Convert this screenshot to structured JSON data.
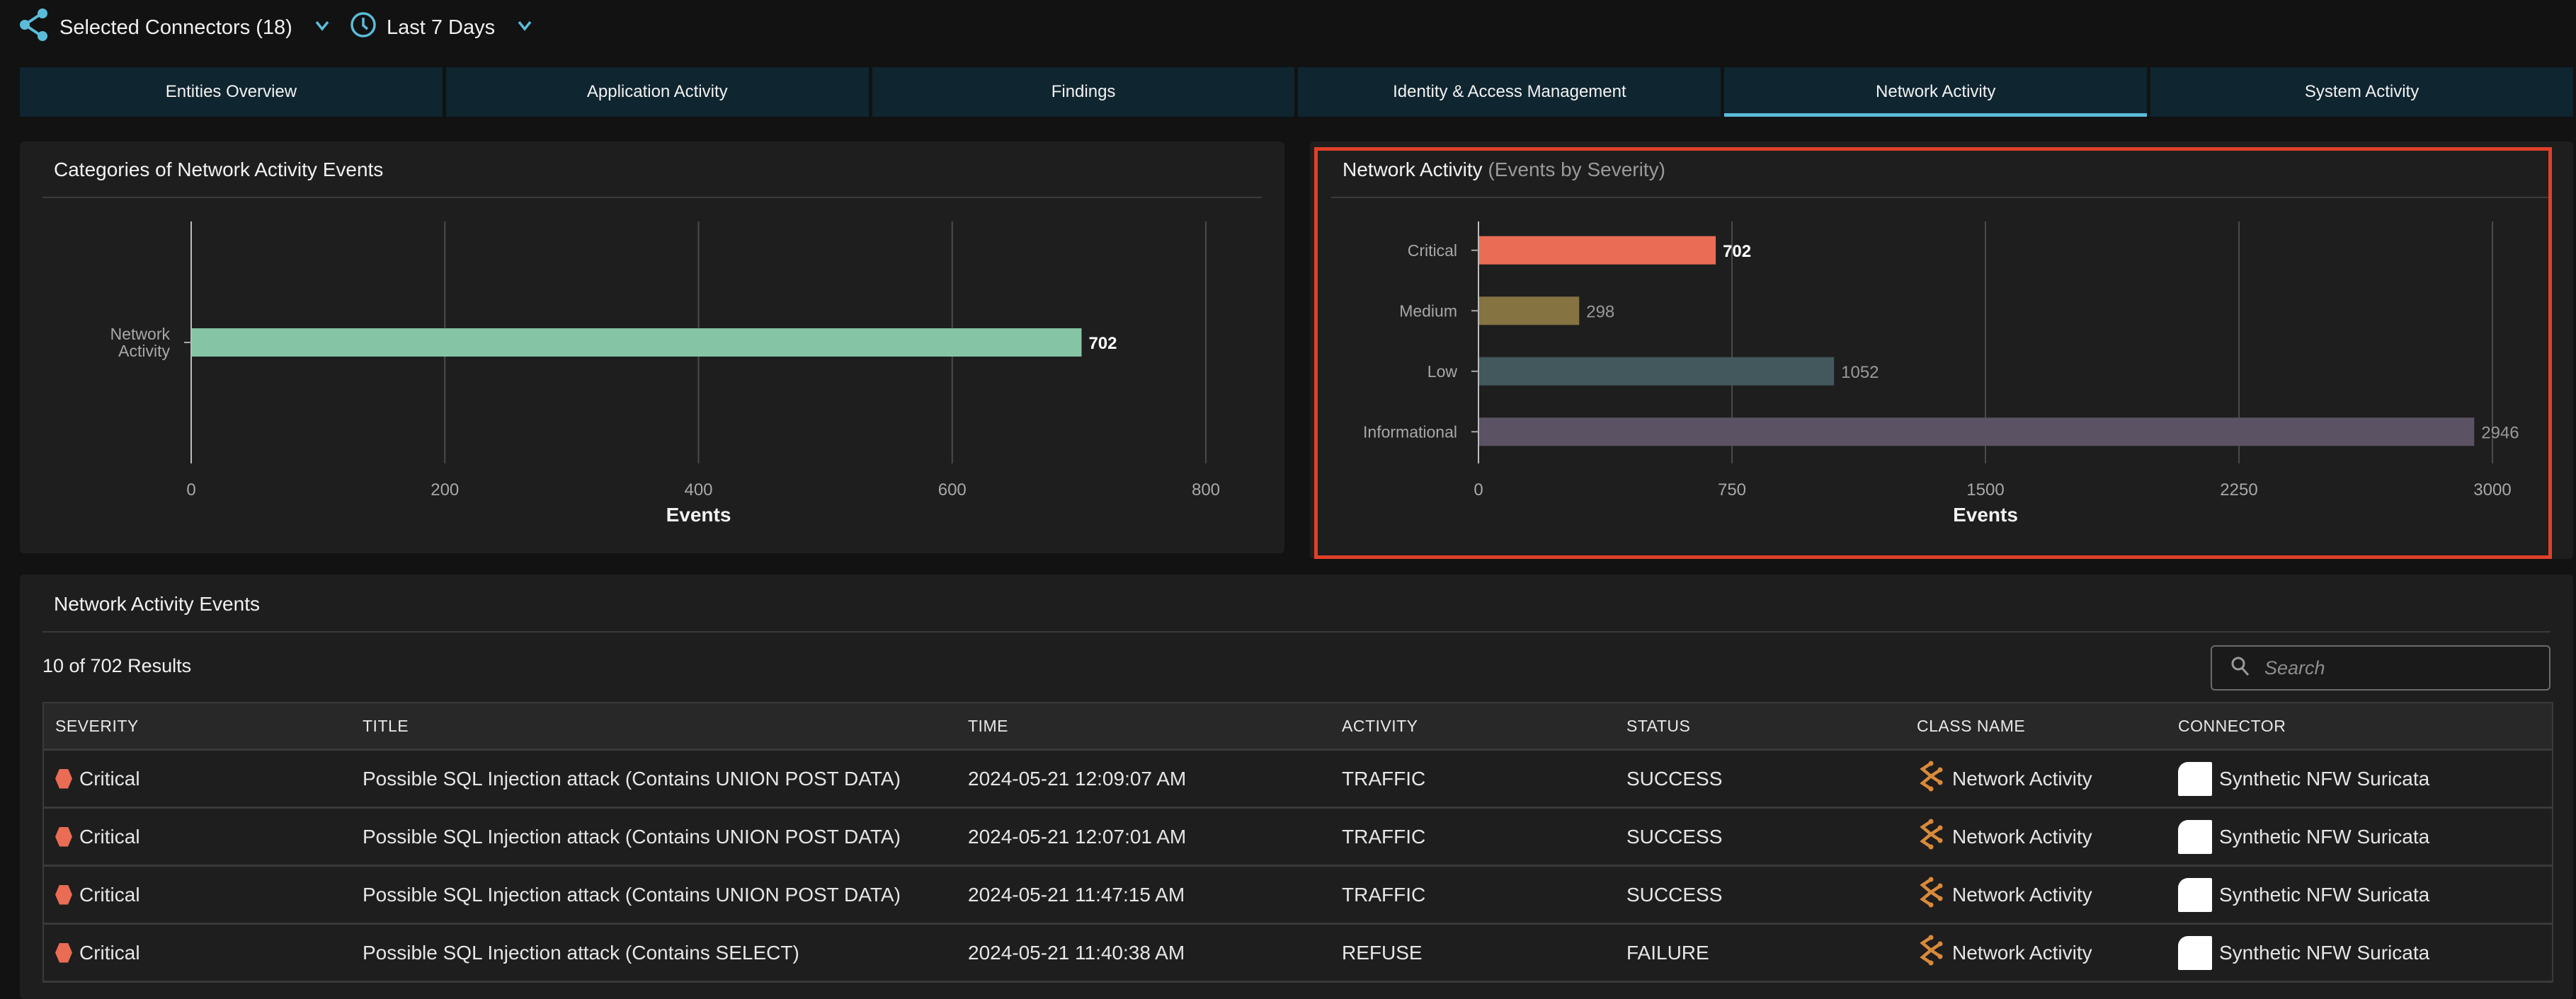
{
  "topbar": {
    "connectors_label": "Selected Connectors (18)",
    "time_range_label": "Last 7 Days",
    "accent_color": "#5bbcd9"
  },
  "tabs": [
    {
      "label": "Entities Overview",
      "active": false
    },
    {
      "label": "Application Activity",
      "active": false
    },
    {
      "label": "Findings",
      "active": false
    },
    {
      "label": "Identity & Access Management",
      "active": false
    },
    {
      "label": "Network Activity",
      "active": true
    },
    {
      "label": "System Activity",
      "active": false
    }
  ],
  "left_card": {
    "title": "Categories of Network Activity Events"
  },
  "right_card": {
    "title": "Network Activity",
    "subtitle": "(Events by Severity)",
    "highlight_color": "#e0402a"
  },
  "chart_data": [
    {
      "type": "bar",
      "orientation": "horizontal",
      "title": "Categories of Network Activity Events",
      "categories": [
        "Network Activity"
      ],
      "category_lines": [
        [
          "Network",
          "Activity"
        ]
      ],
      "values": [
        702
      ],
      "colors": [
        "#85c5a5"
      ],
      "xlabel": "Events",
      "ylabel": "",
      "xlim": [
        0,
        800
      ],
      "xticks": [
        0,
        200,
        400,
        600,
        800
      ],
      "grid": true,
      "data_labels": [
        "702"
      ]
    },
    {
      "type": "bar",
      "orientation": "horizontal",
      "title": "Network Activity (Events by Severity)",
      "categories": [
        "Critical",
        "Medium",
        "Low",
        "Informational"
      ],
      "category_lines": [
        [
          "Critical"
        ],
        [
          "Medium"
        ],
        [
          "Low"
        ],
        [
          "Informational"
        ]
      ],
      "values": [
        702,
        298,
        1052,
        2946
      ],
      "colors": [
        "#ea6c55",
        "#857342",
        "#43585d",
        "#5b5263"
      ],
      "label_colors": [
        "#ffffff",
        "#9a9a9a",
        "#9a9a9a",
        "#9a9a9a"
      ],
      "xlabel": "Events",
      "ylabel": "",
      "xlim": [
        0,
        3000
      ],
      "xticks": [
        0,
        750,
        1500,
        2250,
        3000
      ],
      "grid": true,
      "data_labels": [
        "702",
        "298",
        "1052",
        "2946"
      ]
    }
  ],
  "events_table": {
    "title": "Network Activity Events",
    "results_text": "10 of 702 Results",
    "search_placeholder": "Search",
    "search_value": "",
    "columns": [
      "SEVERITY",
      "TITLE",
      "TIME",
      "ACTIVITY",
      "STATUS",
      "CLASS NAME",
      "CONNECTOR"
    ],
    "rows": [
      {
        "severity": "Critical",
        "title": "Possible SQL Injection attack (Contains UNION POST DATA)",
        "time": "2024-05-21 12:09:07 AM",
        "activity": "TRAFFIC",
        "status": "SUCCESS",
        "class_name": "Network Activity",
        "connector": "Synthetic NFW Suricata"
      },
      {
        "severity": "Critical",
        "title": "Possible SQL Injection attack (Contains UNION POST DATA)",
        "time": "2024-05-21 12:07:01 AM",
        "activity": "TRAFFIC",
        "status": "SUCCESS",
        "class_name": "Network Activity",
        "connector": "Synthetic NFW Suricata"
      },
      {
        "severity": "Critical",
        "title": "Possible SQL Injection attack (Contains UNION POST DATA)",
        "time": "2024-05-21 11:47:15 AM",
        "activity": "TRAFFIC",
        "status": "SUCCESS",
        "class_name": "Network Activity",
        "connector": "Synthetic NFW Suricata"
      },
      {
        "severity": "Critical",
        "title": "Possible SQL Injection attack (Contains SELECT)",
        "time": "2024-05-21 11:40:38 AM",
        "activity": "REFUSE",
        "status": "FAILURE",
        "class_name": "Network Activity",
        "connector": "Synthetic NFW Suricata"
      }
    ],
    "severity_color": "#ea6c55",
    "class_icon_color": "#d98a3a"
  }
}
